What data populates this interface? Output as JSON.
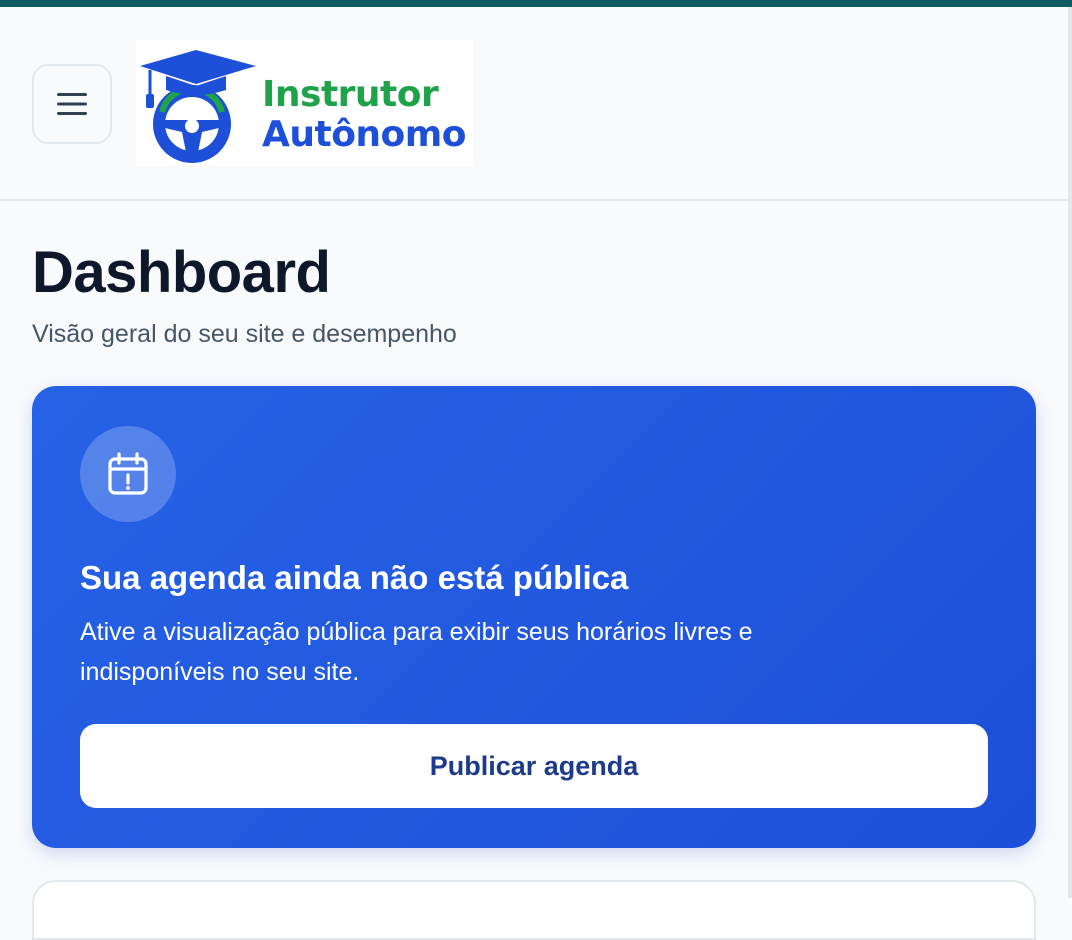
{
  "header": {
    "menu_icon": "hamburger-menu-icon",
    "logo": {
      "line1": "Instrutor",
      "line2": "Autônomo",
      "icon": "graduation-cap-steering-wheel-icon",
      "colors": {
        "green": "#1fa34a",
        "blue": "#1d4fd8"
      }
    }
  },
  "page": {
    "title": "Dashboard",
    "subtitle": "Visão geral do seu site e desempenho"
  },
  "schedule_card": {
    "icon": "calendar-alert-icon",
    "title": "Sua agenda ainda não está pública",
    "text": "Ative a visualização pública para exibir seus horários livres e indisponíveis no seu site.",
    "button_label": "Publicar agenda",
    "colors": {
      "background": "#2662e6",
      "button_text": "#1e3a8a"
    }
  }
}
